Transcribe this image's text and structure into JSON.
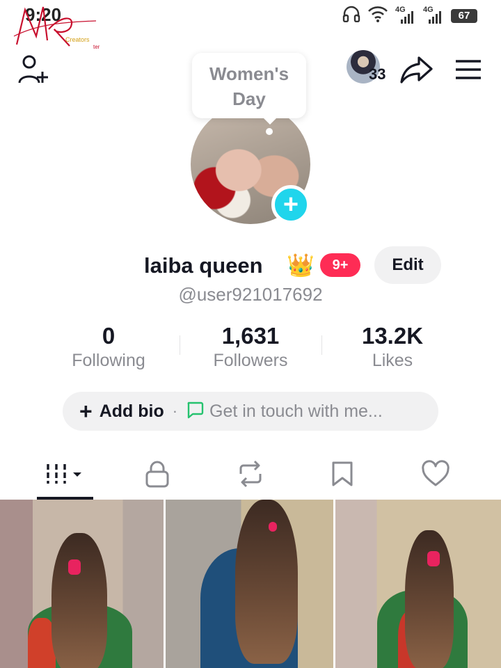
{
  "status_bar": {
    "time": "9:20",
    "network_1": "4G",
    "network_2": "4G",
    "battery": "67"
  },
  "watermark": {
    "line1": "Creators",
    "line2": "ter"
  },
  "header": {
    "story_count": "33",
    "tooltip_line1": "Women's",
    "tooltip_line2": "Day"
  },
  "profile": {
    "display_name": "laiba queen",
    "crown_emoji": "👑",
    "notification_badge": "9+",
    "edit_label": "Edit",
    "username": "@user921017692"
  },
  "stats": [
    {
      "value": "0",
      "label": "Following"
    },
    {
      "value": "1,631",
      "label": "Followers"
    },
    {
      "value": "13.2K",
      "label": "Likes"
    }
  ],
  "bio": {
    "add_plus": "+",
    "add_label": "Add bio",
    "separator": "·",
    "contact_label": "Get in touch with me..."
  },
  "tabs": [
    {
      "icon": "videos-grid-icon",
      "active": true
    },
    {
      "icon": "lock-icon",
      "active": false
    },
    {
      "icon": "repost-icon",
      "active": false
    },
    {
      "icon": "bookmark-icon",
      "active": false
    },
    {
      "icon": "heart-icon",
      "active": false
    }
  ],
  "colors": {
    "accent_cyan": "#20d5ec",
    "badge_red": "#fe2c55",
    "text_primary": "#161823",
    "text_secondary": "#8a8b91",
    "pill_bg": "#f1f1f2"
  }
}
